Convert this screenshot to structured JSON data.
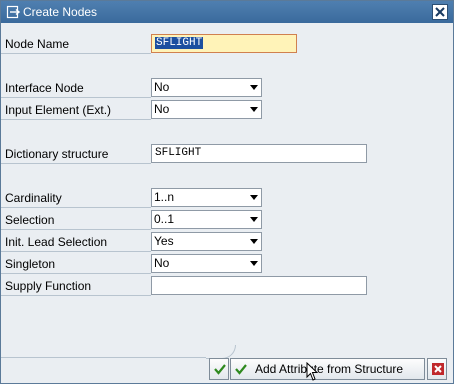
{
  "window": {
    "title": "Create Nodes"
  },
  "fields": {
    "node_name": {
      "label": "Node Name",
      "value": "SFLIGHT"
    },
    "interface_node": {
      "label": "Interface Node",
      "value": "No"
    },
    "input_element": {
      "label": "Input Element (Ext.)",
      "value": "No"
    },
    "dictionary_structure": {
      "label": "Dictionary structure",
      "value": "SFLIGHT"
    },
    "cardinality": {
      "label": "Cardinality",
      "value": "1..n"
    },
    "selection": {
      "label": "Selection",
      "value": "0..1"
    },
    "init_lead_selection": {
      "label": "Init. Lead Selection",
      "value": "Yes"
    },
    "singleton": {
      "label": "Singleton",
      "value": "No"
    },
    "supply_function": {
      "label": "Supply Function",
      "value": ""
    }
  },
  "buttons": {
    "add_attribute_label": "Add Attribute from Structure"
  },
  "colors": {
    "titlebar": "#3a6a9c",
    "confirm_green": "#2f8a1f",
    "cancel_red": "#c0282b",
    "selection_highlight": "#1c4fa0"
  }
}
